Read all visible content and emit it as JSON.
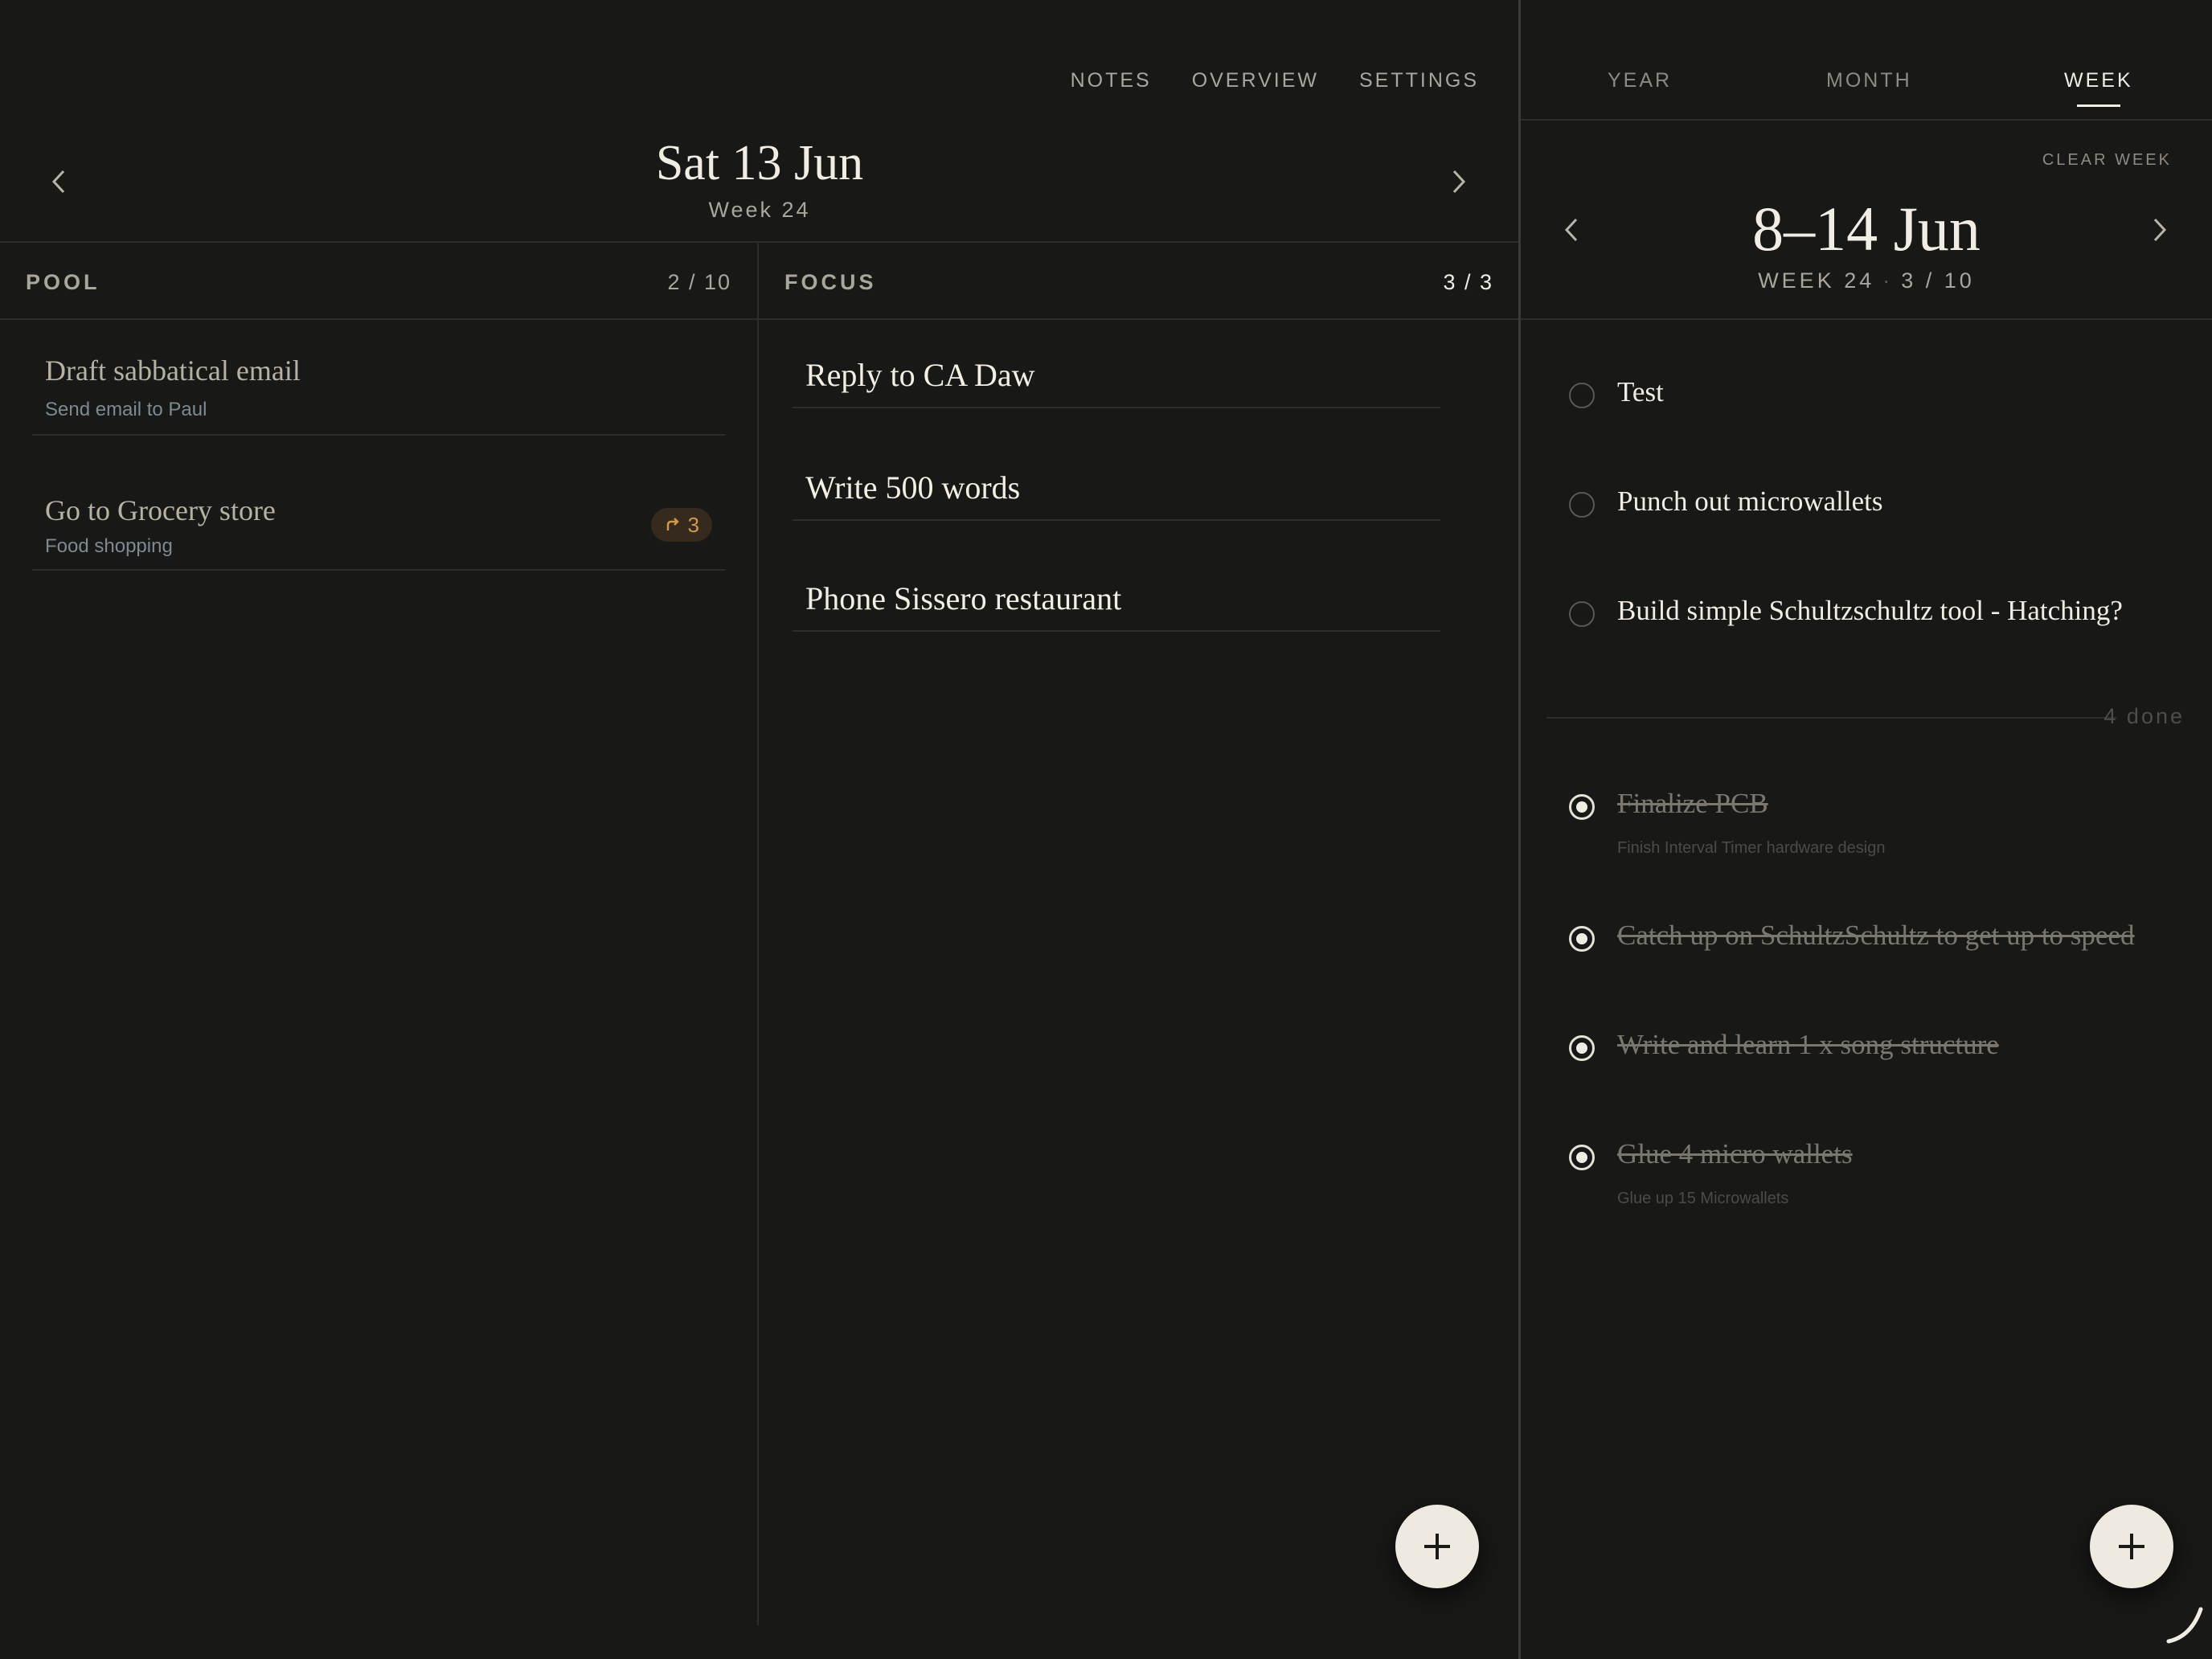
{
  "nav": {
    "items": [
      "NOTES",
      "OVERVIEW",
      "SETTINGS"
    ]
  },
  "day": {
    "title": "Sat 13 Jun",
    "subtitle": "Week 24"
  },
  "pool": {
    "title": "POOL",
    "count": "2 / 10",
    "items": [
      {
        "title": "Draft sabbatical email",
        "subtitle": "Send email to Paul"
      },
      {
        "title": "Go to Grocery store",
        "subtitle": "Food shopping",
        "badge": "3"
      }
    ]
  },
  "focus": {
    "title": "FOCUS",
    "count": "3 / 3",
    "items": [
      {
        "title": "Reply to CA Daw"
      },
      {
        "title": "Write 500 words"
      },
      {
        "title": "Phone Sissero restaurant"
      }
    ]
  },
  "right": {
    "tabs": [
      "YEAR",
      "MONTH",
      "WEEK"
    ],
    "active_tab": "WEEK",
    "clear_label": "CLEAR WEEK",
    "week_title": "8–14 Jun",
    "week_label": "WEEK 24",
    "week_count": "3 / 10",
    "open_items": [
      {
        "title": "Test"
      },
      {
        "title": "Punch out microwallets"
      },
      {
        "title": "Build simple Schultzschultz tool - Hatching?"
      }
    ],
    "done_label": "4 done",
    "done_items": [
      {
        "title": "Finalize PCB",
        "subtitle": "Finish Interval Timer hardware design"
      },
      {
        "title": "Catch up on SchultzSchultz to get up to speed"
      },
      {
        "title": "Write and learn 1 x song structure"
      },
      {
        "title": "Glue 4 micro wallets",
        "subtitle": "Glue up 15 Microwallets"
      }
    ]
  },
  "colors": {
    "background": "#181817",
    "text": "#f1ede4",
    "accent_badge": "#d39a4b",
    "subtitle_blue": "#7d8a93"
  }
}
